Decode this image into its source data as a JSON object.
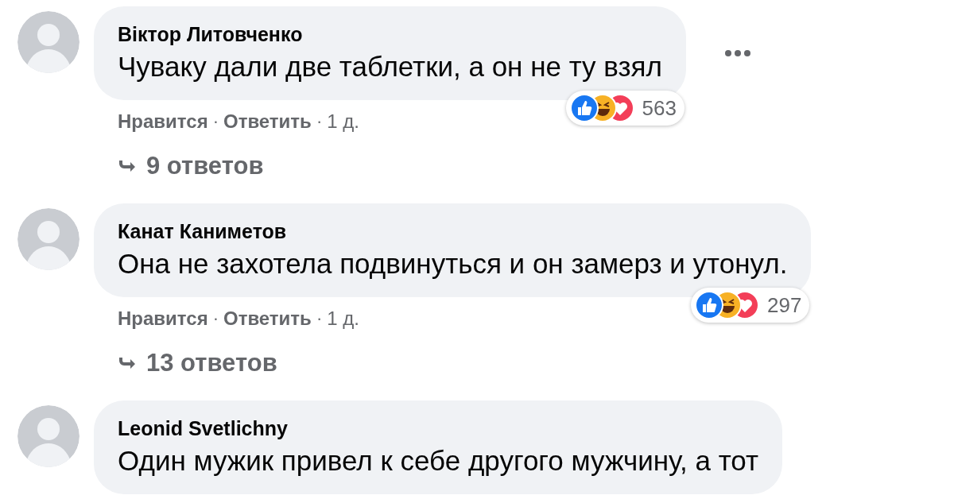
{
  "comments": [
    {
      "author": "Віктор Литовченко",
      "text": "Чуваку дали две таблетки, а он не ту взял",
      "more_button": true,
      "reactions": {
        "count": "563"
      },
      "actions": {
        "like": "Нравится",
        "separator": "·",
        "reply": "Ответить",
        "time": "1 д."
      },
      "replies": "9 ответов"
    },
    {
      "author": "Канат Каниметов",
      "text": "Она не захотела подвинуться и он замерз и утонул.",
      "more_button": false,
      "reactions": {
        "count": "297"
      },
      "actions": {
        "like": "Нравится",
        "separator": "·",
        "reply": "Ответить",
        "time": "1 д."
      },
      "replies": "13 ответов"
    },
    {
      "author": "Leonid Svetlichny",
      "text": "Один мужик привел к себе другого мужчину, а тот",
      "more_button": false
    }
  ]
}
